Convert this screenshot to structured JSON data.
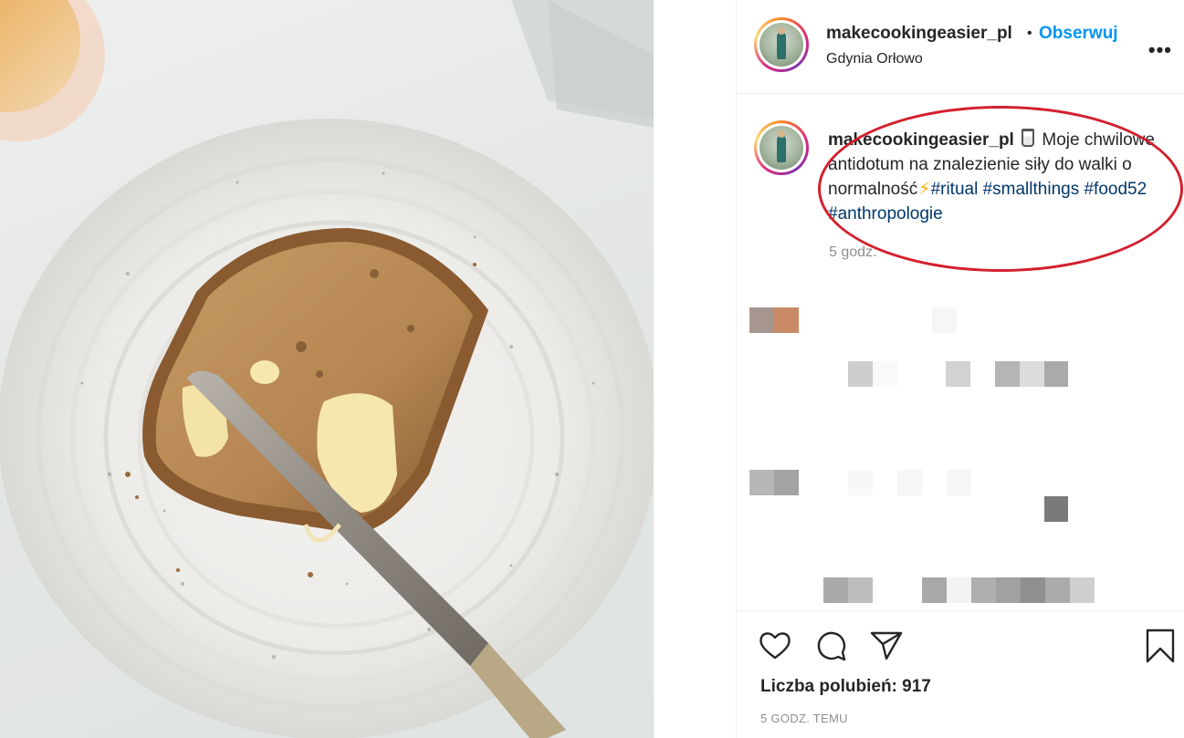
{
  "post": {
    "username": "makecookingeasier_pl",
    "separator": "•",
    "follow_label": "Obserwuj",
    "location": "Gdynia Orłowo",
    "more_label": "•••"
  },
  "caption": {
    "username": "makecookingeasier_pl",
    "text": "Moje chwilowe antidotum na znalezienie siły do walki o normalność",
    "bolt": "⚡",
    "hashtags": [
      "#ritual",
      "#smallthings",
      "#food52",
      "#anthropologie"
    ],
    "time": "5 godz."
  },
  "actions": {
    "likes_label": "Liczba polubień: 917",
    "posted_ago": "5 GODZ. TEMU"
  },
  "icons": {
    "like": "heart-icon",
    "comment": "comment-icon",
    "share": "send-icon",
    "save": "bookmark-icon",
    "more": "more-icon"
  },
  "colors": {
    "follow": "#0095f6",
    "hashtag": "#00376b",
    "annotation": "#d3202d",
    "muted": "#8e8e8e"
  }
}
